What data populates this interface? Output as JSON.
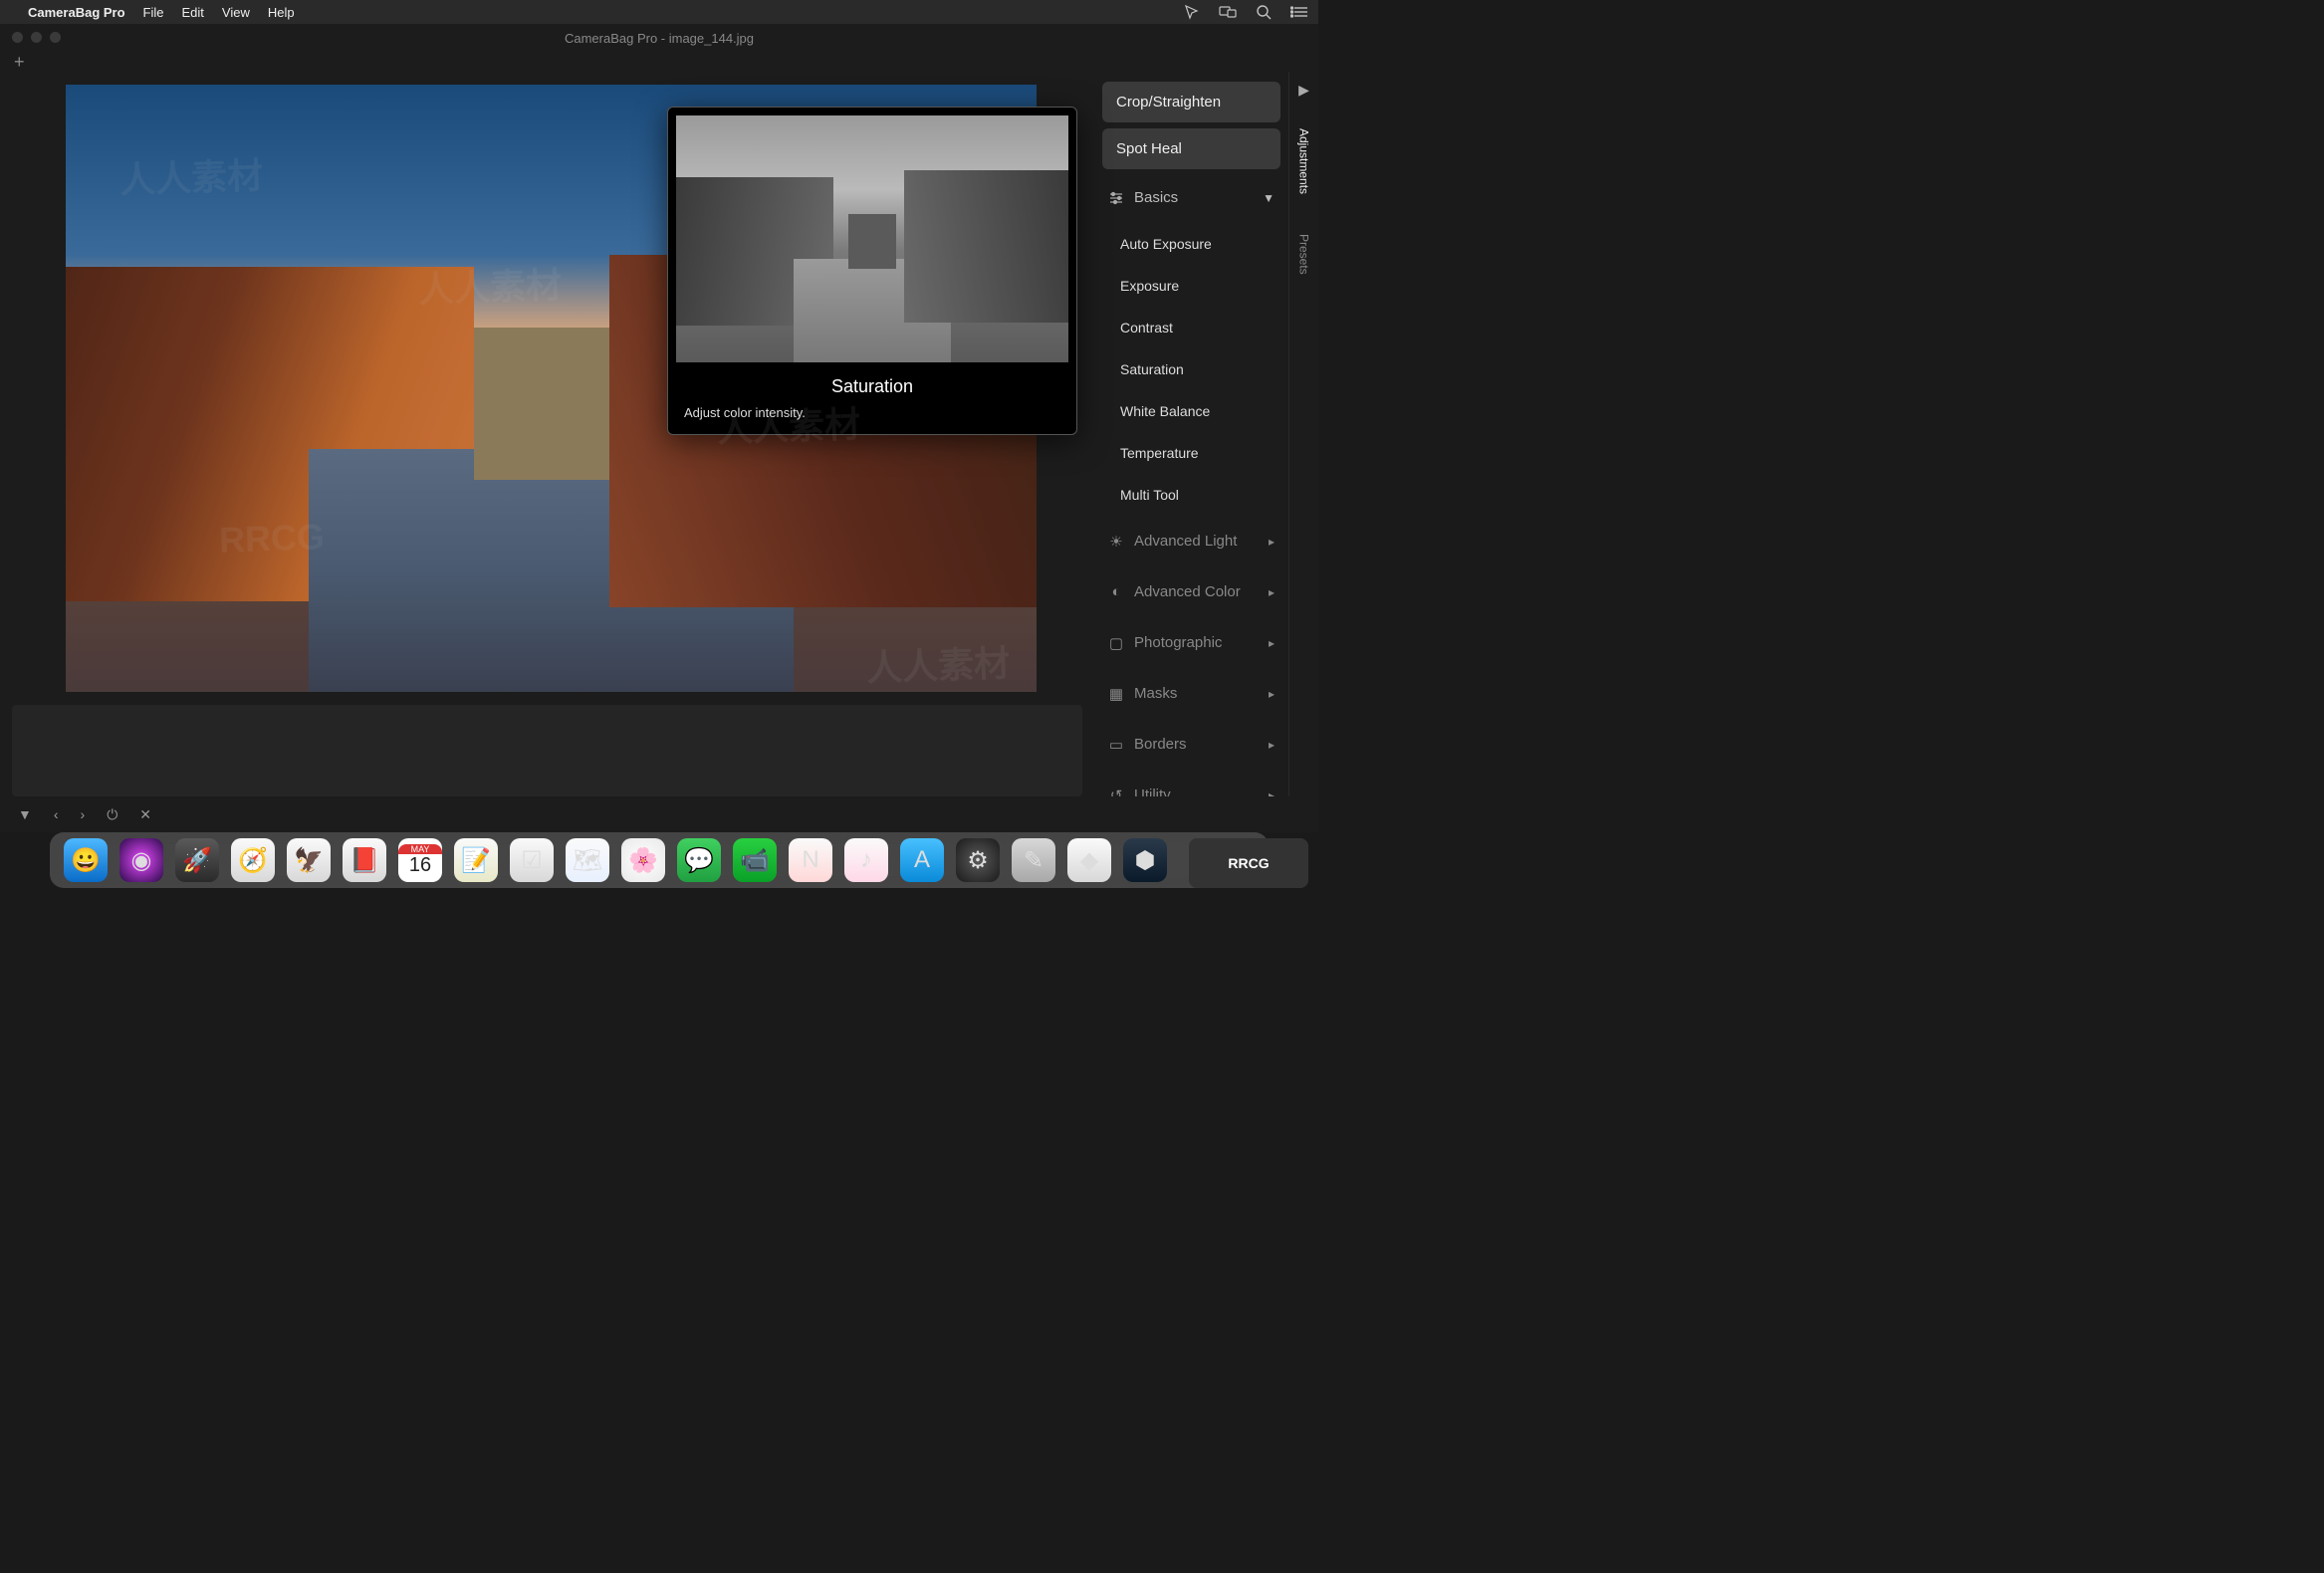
{
  "menubar": {
    "app": "CameraBag Pro",
    "items": [
      "File",
      "Edit",
      "View",
      "Help"
    ]
  },
  "window": {
    "title": "CameraBag Pro - image_144.jpg"
  },
  "tooltip": {
    "title": "Saturation",
    "desc": "Adjust color intensity."
  },
  "panel": {
    "crop": "Crop/Straighten",
    "spot": "Spot Heal",
    "sections": {
      "basics": "Basics",
      "advlight": "Advanced Light",
      "advcolor": "Advanced Color",
      "photo": "Photographic",
      "masks": "Masks",
      "borders": "Borders",
      "utility": "Utility"
    },
    "basics_items": [
      "Auto Exposure",
      "Exposure",
      "Contrast",
      "Saturation",
      "White Balance",
      "Temperature",
      "Multi Tool"
    ]
  },
  "sidetabs": {
    "adjustments": "Adjustments",
    "presets": "Presets"
  },
  "dock": {
    "date_badge": "16",
    "date_month": "MAY"
  },
  "footer": {
    "triangle": "▼",
    "prev": "‹",
    "next": "›",
    "power": "⏻",
    "close": "✕"
  },
  "brand_logo": "RRCG"
}
